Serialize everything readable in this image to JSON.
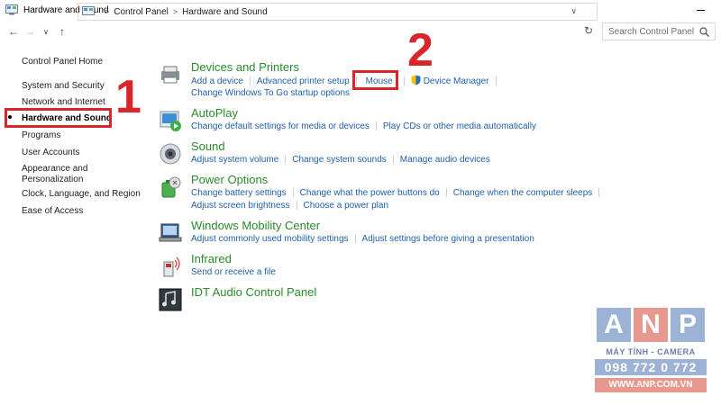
{
  "window": {
    "title": "Hardware and Sound"
  },
  "nav": {
    "breadcrumb": [
      "Control Panel",
      "Hardware and Sound"
    ],
    "search_placeholder": "Search Control Panel"
  },
  "sidebar": {
    "items": [
      {
        "label": "Control Panel Home"
      },
      {
        "label": "System and Security"
      },
      {
        "label": "Network and Internet"
      },
      {
        "label": "Hardware and Sound",
        "active": true
      },
      {
        "label": "Programs"
      },
      {
        "label": "User Accounts"
      },
      {
        "label": "Appearance and"
      },
      {
        "label": "Personalization"
      },
      {
        "label": "Clock, Language, and Region"
      },
      {
        "label": "Ease of Access"
      }
    ]
  },
  "annotations": {
    "step1": "1",
    "step2": "2"
  },
  "categories": [
    {
      "title": "Devices and Printers",
      "icon": "printer-icon",
      "links": [
        [
          "Add a device",
          "Advanced printer setup",
          "Mouse",
          "Device Manager"
        ],
        [
          "Change Windows To Go startup options"
        ]
      ]
    },
    {
      "title": "AutoPlay",
      "icon": "autoplay-icon",
      "links": [
        [
          "Change default settings for media or devices",
          "Play CDs or other media automatically"
        ]
      ]
    },
    {
      "title": "Sound",
      "icon": "speaker-icon",
      "links": [
        [
          "Adjust system volume",
          "Change system sounds",
          "Manage audio devices"
        ]
      ]
    },
    {
      "title": "Power Options",
      "icon": "power-options-icon",
      "links": [
        [
          "Change battery settings",
          "Change what the power buttons do",
          "Change when the computer sleeps"
        ],
        [
          "Adjust screen brightness",
          "Choose a power plan"
        ]
      ]
    },
    {
      "title": "Windows Mobility Center",
      "icon": "mobility-center-icon",
      "links": [
        [
          "Adjust commonly used mobility settings",
          "Adjust settings before giving a presentation"
        ]
      ]
    },
    {
      "title": "Infrared",
      "icon": "infrared-icon",
      "links": [
        [
          "Send or receive a file"
        ]
      ]
    },
    {
      "title": "IDT Audio Control Panel",
      "icon": "idt-audio-icon",
      "links": []
    }
  ],
  "watermark": {
    "letters": [
      "A",
      "N",
      "P"
    ],
    "colors": [
      "#9db3d6",
      "#e8998f",
      "#9db3d6"
    ],
    "tagline": "MÁY TÍNH - CAMERA",
    "phone": "098 772 0 772",
    "website": "WWW.ANP.COM.VN"
  }
}
